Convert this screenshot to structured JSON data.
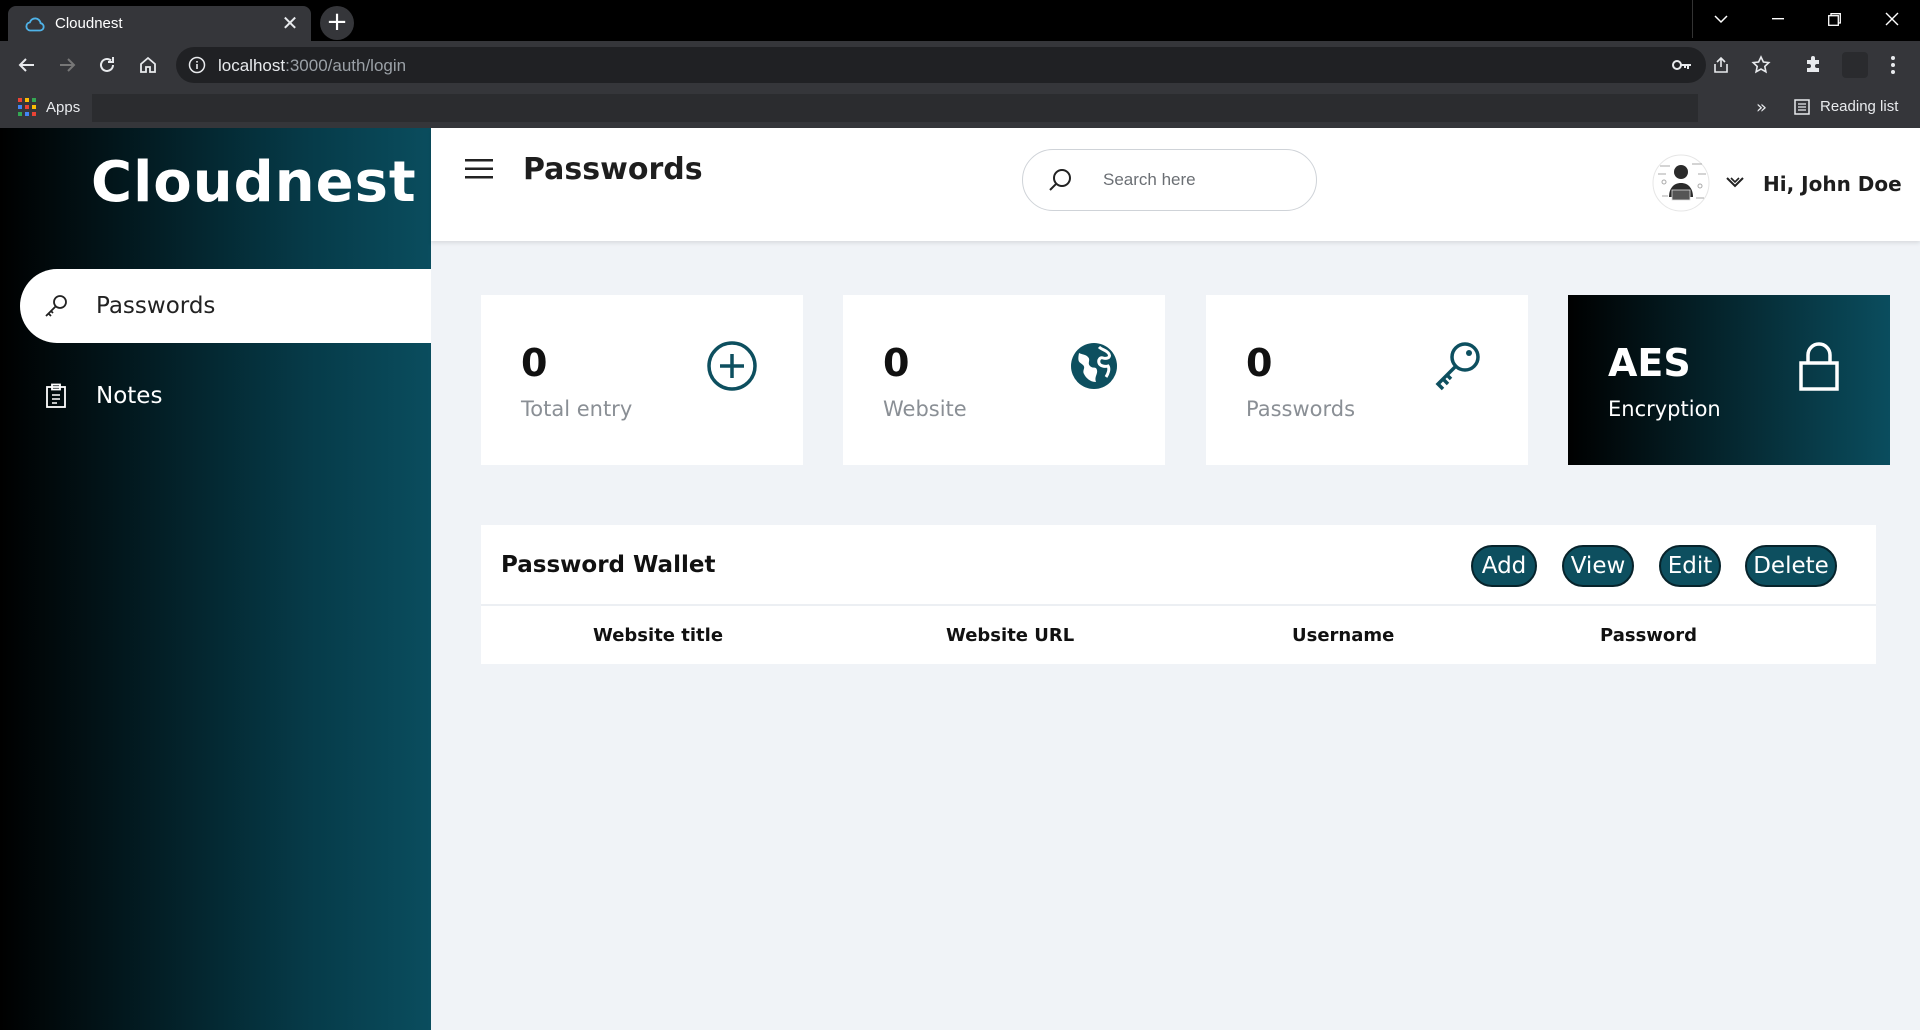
{
  "browser": {
    "tab_title": "Cloudnest",
    "url_host": "localhost",
    "url_path": ":3000/auth/login",
    "bookmarks": {
      "apps_label": "Apps",
      "more": "»",
      "reading_list": "Reading list"
    }
  },
  "sidebar": {
    "brand": "Cloudnest",
    "items": [
      {
        "label": "Passwords",
        "icon": "key-icon",
        "active": true
      },
      {
        "label": "Notes",
        "icon": "clipboard-icon",
        "active": false
      }
    ]
  },
  "header": {
    "title": "Passwords",
    "search_placeholder": "Search here",
    "greeting": "Hi, John Doe"
  },
  "stats": [
    {
      "value": "0",
      "label": "Total entry",
      "icon": "plus-circle-icon"
    },
    {
      "value": "0",
      "label": "Website",
      "icon": "globe-icon"
    },
    {
      "value": "0",
      "label": "Passwords",
      "icon": "key-icon"
    },
    {
      "value": "AES",
      "label": "Encryption",
      "icon": "lock-icon"
    }
  ],
  "wallet": {
    "title": "Password Wallet",
    "buttons": {
      "add": "Add",
      "view": "View",
      "edit": "Edit",
      "delete": "Delete"
    },
    "columns": [
      "Website title",
      "Website URL",
      "Username",
      "Password"
    ]
  },
  "colors": {
    "accent": "#0d4f5f",
    "sidebar_dark": "#000000",
    "sidebar_teal": "#0a4d5e",
    "page_bg": "#f0f3f7"
  }
}
